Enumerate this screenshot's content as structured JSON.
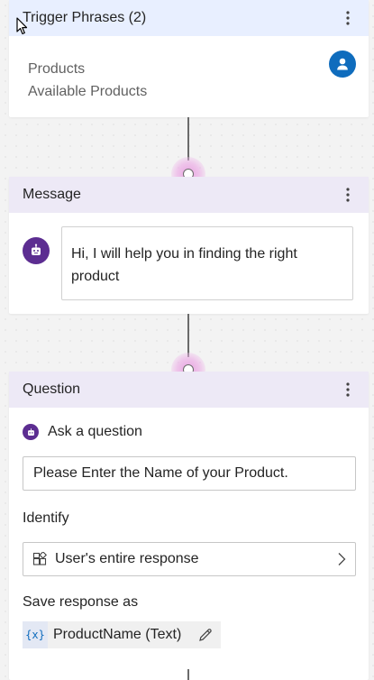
{
  "trigger": {
    "title": "Trigger Phrases (2)",
    "phrases": [
      "Products",
      "Available Products"
    ]
  },
  "message": {
    "title": "Message",
    "text": "Hi, I will help you in finding the right product"
  },
  "question": {
    "title": "Question",
    "ask_label": "Ask a question",
    "prompt_value": "Please Enter the Name of your Product.",
    "identify_label": "Identify",
    "identify_value": "User's entire response",
    "save_label": "Save response as",
    "variable_icon": "{x}",
    "variable_name": "ProductName (Text)"
  },
  "colors": {
    "trigger_header": "#e8efff",
    "node_header": "#ede9f6",
    "bot_avatar": "#5c2d91",
    "user_avatar": "#0f6cbd"
  }
}
